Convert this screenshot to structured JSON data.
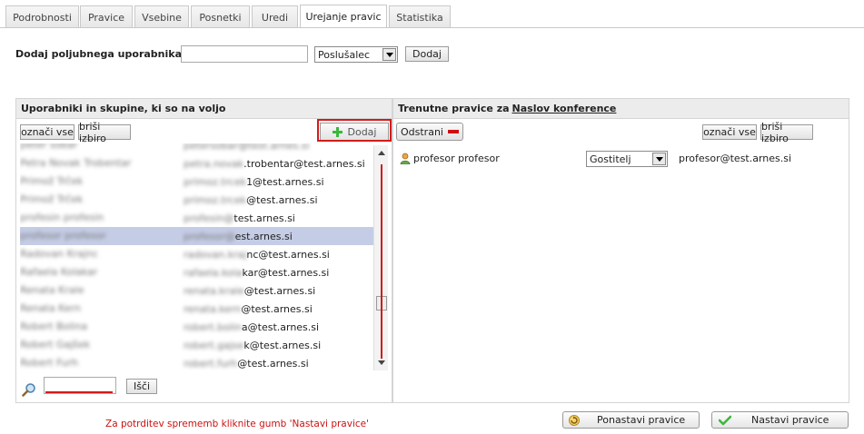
{
  "tabs": [
    {
      "label": "Podrobnosti",
      "active": false
    },
    {
      "label": "Pravice",
      "active": false
    },
    {
      "label": "Vsebine",
      "active": false
    },
    {
      "label": "Posnetki",
      "active": false
    },
    {
      "label": "Uredi",
      "active": false
    },
    {
      "label": "Urejanje pravic",
      "active": true
    },
    {
      "label": "Statistika",
      "active": false
    }
  ],
  "add_user": {
    "label": "Dodaj poljubnega uporabnika:",
    "input_value": "",
    "role_selected": "Poslušalec",
    "button": "Dodaj"
  },
  "available": {
    "title": "Uporabniki in skupine, ki so na voljo",
    "select_all": "označi vse",
    "clear_selection": "briši izbiro",
    "add_button": "Dodaj",
    "rows": [
      {
        "name": "peter sobar",
        "email_blur": "petersobar",
        "email": "@test.arnes.si",
        "selected": false
      },
      {
        "name": "Petra Novak Trobentar",
        "email_blur": "petra.novak",
        "email": ".trobentar@test.arnes.si",
        "selected": false
      },
      {
        "name": "Primož Trček",
        "email_blur": "primoz.trcek",
        "email": "1@test.arnes.si",
        "selected": false
      },
      {
        "name": "Primož Trček",
        "email_blur": "primoz.trcek",
        "email": "@test.arnes.si",
        "selected": false
      },
      {
        "name": "profesin profesin",
        "email_blur": "profesin@",
        "email": "test.arnes.si",
        "selected": false
      },
      {
        "name": "profesor profesor",
        "email_blur": "profesor@",
        "email": "est.arnes.si",
        "selected": true
      },
      {
        "name": "Radovan Krajnc",
        "email_blur": "radovan.kraj",
        "email": "nc@test.arnes.si",
        "selected": false
      },
      {
        "name": "Rafaela Kolakar",
        "email_blur": "rafaela.kola",
        "email": "kar@test.arnes.si",
        "selected": false
      },
      {
        "name": "Renata Krale",
        "email_blur": "renata.krale",
        "email": "@test.arnes.si",
        "selected": false
      },
      {
        "name": "Renata Kern",
        "email_blur": "renata.kern",
        "email": "@test.arnes.si",
        "selected": false
      },
      {
        "name": "Robert Bolina",
        "email_blur": "robert.bolin",
        "email": "a@test.arnes.si",
        "selected": false
      },
      {
        "name": "Robert Gajšek",
        "email_blur": "robert.gajse",
        "email": "k@test.arnes.si",
        "selected": false
      },
      {
        "name": "Robert Furh",
        "email_blur": "robert.furh",
        "email": "@test.arnes.si",
        "selected": false
      }
    ],
    "search_value": "",
    "search_button": "Išči"
  },
  "current": {
    "title_prefix": "Trenutne pravice za",
    "conference_name": "Naslov konference",
    "remove_button": "Odstrani",
    "select_all": "označi vse",
    "clear_selection": "briši izbiro",
    "rows": [
      {
        "name": "profesor profesor",
        "role": "Gostitelj",
        "email": "profesor@test.arnes.si"
      }
    ]
  },
  "footer": {
    "note": "Za potrditev sprememb kliknite gumb 'Nastavi pravice'",
    "reset_button": "Ponastavi pravice",
    "apply_button": "Nastavi pravice"
  },
  "colors": {
    "accent_red": "#d21b1b",
    "add_green": "#3cb83c",
    "remove_red": "#cc1111",
    "selected_row": "#c5cde6"
  }
}
